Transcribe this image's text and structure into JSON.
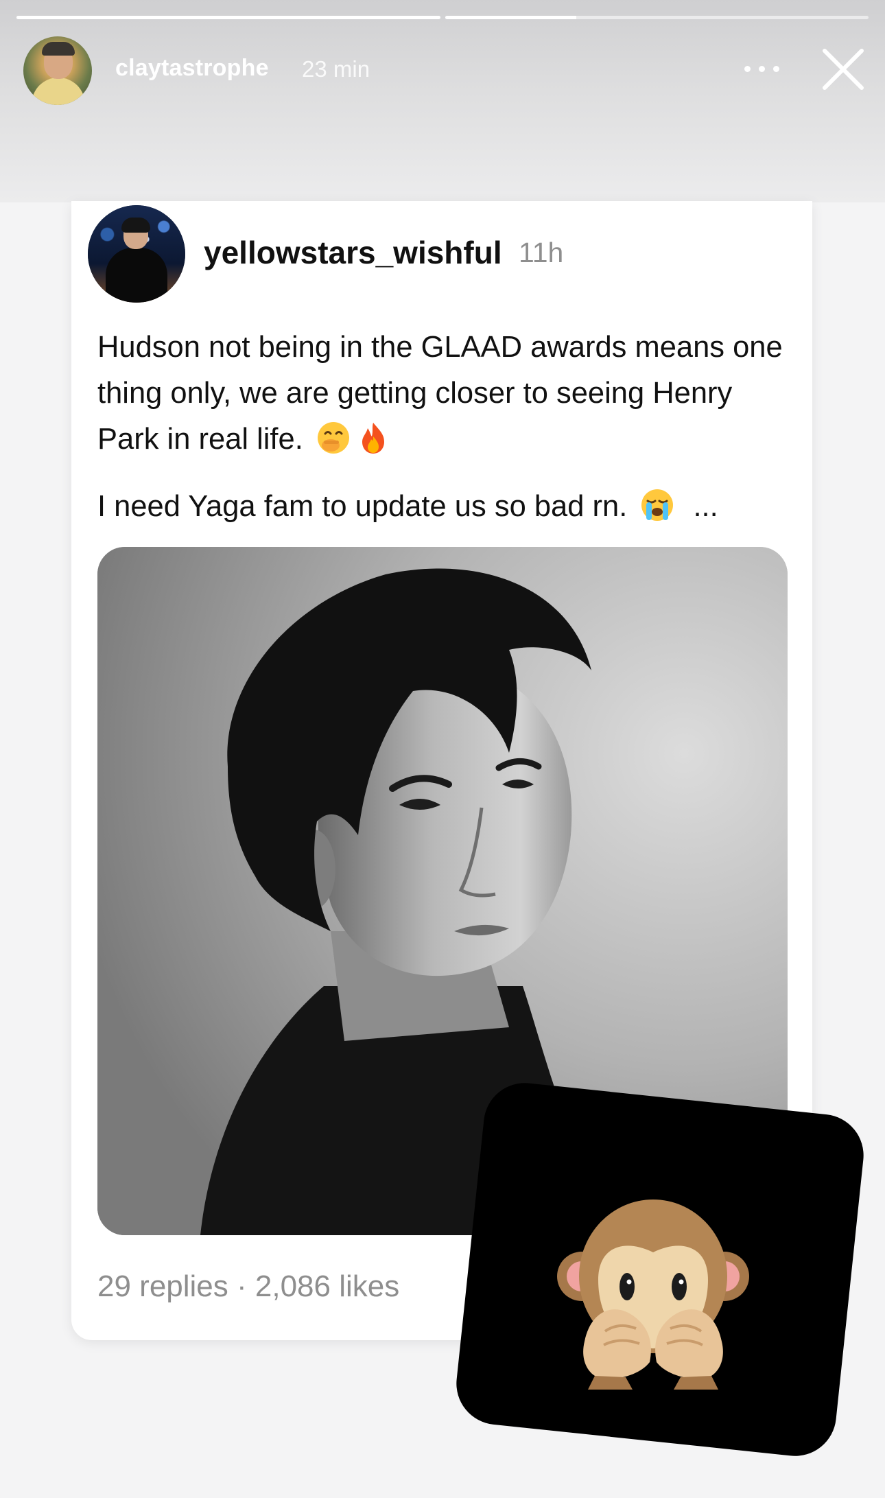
{
  "story": {
    "username": "claytastrophe",
    "time": "23 min",
    "progress": [
      1.0,
      0.31
    ]
  },
  "post": {
    "username": "yellowstars_wishful",
    "time": "11h",
    "paragraphs": [
      "Hudson not being in the GLAAD awards means one thing only, we are getting closer to seeing Henry Park in real life.",
      "I need Yaga fam to update us so bad rn."
    ],
    "paragraph1_emojis": [
      "hand-over-mouth-emoji",
      "fire-emoji"
    ],
    "paragraph2_emoji": "loudly-crying-emoji",
    "truncation": "...",
    "stats": "29 replies · 2,086 likes"
  },
  "sticker": {
    "icon": "see-no-evil-monkey-emoji"
  }
}
